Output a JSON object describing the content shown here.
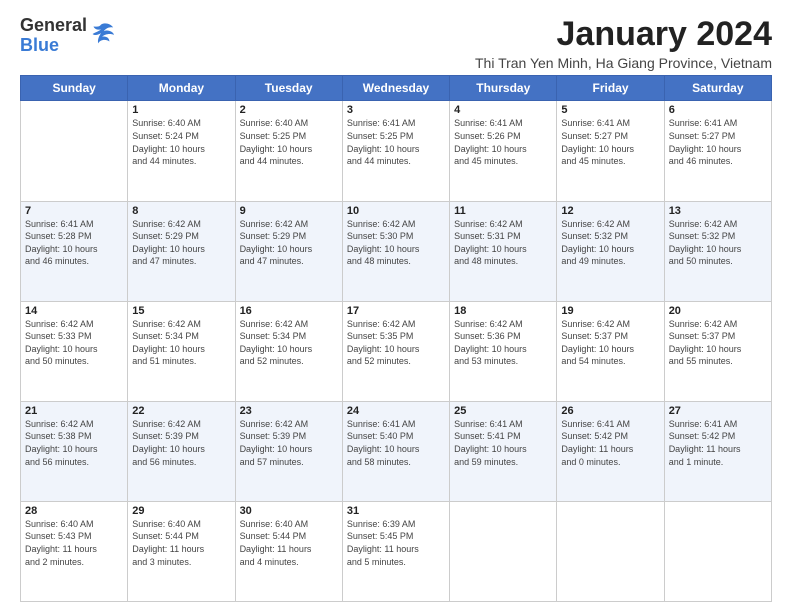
{
  "logo": {
    "general": "General",
    "blue": "Blue"
  },
  "title": "January 2024",
  "location": "Thi Tran Yen Minh, Ha Giang Province, Vietnam",
  "days_of_week": [
    "Sunday",
    "Monday",
    "Tuesday",
    "Wednesday",
    "Thursday",
    "Friday",
    "Saturday"
  ],
  "weeks": [
    [
      {
        "day": "",
        "info": ""
      },
      {
        "day": "1",
        "info": "Sunrise: 6:40 AM\nSunset: 5:24 PM\nDaylight: 10 hours\nand 44 minutes."
      },
      {
        "day": "2",
        "info": "Sunrise: 6:40 AM\nSunset: 5:25 PM\nDaylight: 10 hours\nand 44 minutes."
      },
      {
        "day": "3",
        "info": "Sunrise: 6:41 AM\nSunset: 5:25 PM\nDaylight: 10 hours\nand 44 minutes."
      },
      {
        "day": "4",
        "info": "Sunrise: 6:41 AM\nSunset: 5:26 PM\nDaylight: 10 hours\nand 45 minutes."
      },
      {
        "day": "5",
        "info": "Sunrise: 6:41 AM\nSunset: 5:27 PM\nDaylight: 10 hours\nand 45 minutes."
      },
      {
        "day": "6",
        "info": "Sunrise: 6:41 AM\nSunset: 5:27 PM\nDaylight: 10 hours\nand 46 minutes."
      }
    ],
    [
      {
        "day": "7",
        "info": "Sunrise: 6:41 AM\nSunset: 5:28 PM\nDaylight: 10 hours\nand 46 minutes."
      },
      {
        "day": "8",
        "info": "Sunrise: 6:42 AM\nSunset: 5:29 PM\nDaylight: 10 hours\nand 47 minutes."
      },
      {
        "day": "9",
        "info": "Sunrise: 6:42 AM\nSunset: 5:29 PM\nDaylight: 10 hours\nand 47 minutes."
      },
      {
        "day": "10",
        "info": "Sunrise: 6:42 AM\nSunset: 5:30 PM\nDaylight: 10 hours\nand 48 minutes."
      },
      {
        "day": "11",
        "info": "Sunrise: 6:42 AM\nSunset: 5:31 PM\nDaylight: 10 hours\nand 48 minutes."
      },
      {
        "day": "12",
        "info": "Sunrise: 6:42 AM\nSunset: 5:32 PM\nDaylight: 10 hours\nand 49 minutes."
      },
      {
        "day": "13",
        "info": "Sunrise: 6:42 AM\nSunset: 5:32 PM\nDaylight: 10 hours\nand 50 minutes."
      }
    ],
    [
      {
        "day": "14",
        "info": "Sunrise: 6:42 AM\nSunset: 5:33 PM\nDaylight: 10 hours\nand 50 minutes."
      },
      {
        "day": "15",
        "info": "Sunrise: 6:42 AM\nSunset: 5:34 PM\nDaylight: 10 hours\nand 51 minutes."
      },
      {
        "day": "16",
        "info": "Sunrise: 6:42 AM\nSunset: 5:34 PM\nDaylight: 10 hours\nand 52 minutes."
      },
      {
        "day": "17",
        "info": "Sunrise: 6:42 AM\nSunset: 5:35 PM\nDaylight: 10 hours\nand 52 minutes."
      },
      {
        "day": "18",
        "info": "Sunrise: 6:42 AM\nSunset: 5:36 PM\nDaylight: 10 hours\nand 53 minutes."
      },
      {
        "day": "19",
        "info": "Sunrise: 6:42 AM\nSunset: 5:37 PM\nDaylight: 10 hours\nand 54 minutes."
      },
      {
        "day": "20",
        "info": "Sunrise: 6:42 AM\nSunset: 5:37 PM\nDaylight: 10 hours\nand 55 minutes."
      }
    ],
    [
      {
        "day": "21",
        "info": "Sunrise: 6:42 AM\nSunset: 5:38 PM\nDaylight: 10 hours\nand 56 minutes."
      },
      {
        "day": "22",
        "info": "Sunrise: 6:42 AM\nSunset: 5:39 PM\nDaylight: 10 hours\nand 56 minutes."
      },
      {
        "day": "23",
        "info": "Sunrise: 6:42 AM\nSunset: 5:39 PM\nDaylight: 10 hours\nand 57 minutes."
      },
      {
        "day": "24",
        "info": "Sunrise: 6:41 AM\nSunset: 5:40 PM\nDaylight: 10 hours\nand 58 minutes."
      },
      {
        "day": "25",
        "info": "Sunrise: 6:41 AM\nSunset: 5:41 PM\nDaylight: 10 hours\nand 59 minutes."
      },
      {
        "day": "26",
        "info": "Sunrise: 6:41 AM\nSunset: 5:42 PM\nDaylight: 11 hours\nand 0 minutes."
      },
      {
        "day": "27",
        "info": "Sunrise: 6:41 AM\nSunset: 5:42 PM\nDaylight: 11 hours\nand 1 minute."
      }
    ],
    [
      {
        "day": "28",
        "info": "Sunrise: 6:40 AM\nSunset: 5:43 PM\nDaylight: 11 hours\nand 2 minutes."
      },
      {
        "day": "29",
        "info": "Sunrise: 6:40 AM\nSunset: 5:44 PM\nDaylight: 11 hours\nand 3 minutes."
      },
      {
        "day": "30",
        "info": "Sunrise: 6:40 AM\nSunset: 5:44 PM\nDaylight: 11 hours\nand 4 minutes."
      },
      {
        "day": "31",
        "info": "Sunrise: 6:39 AM\nSunset: 5:45 PM\nDaylight: 11 hours\nand 5 minutes."
      },
      {
        "day": "",
        "info": ""
      },
      {
        "day": "",
        "info": ""
      },
      {
        "day": "",
        "info": ""
      }
    ]
  ]
}
